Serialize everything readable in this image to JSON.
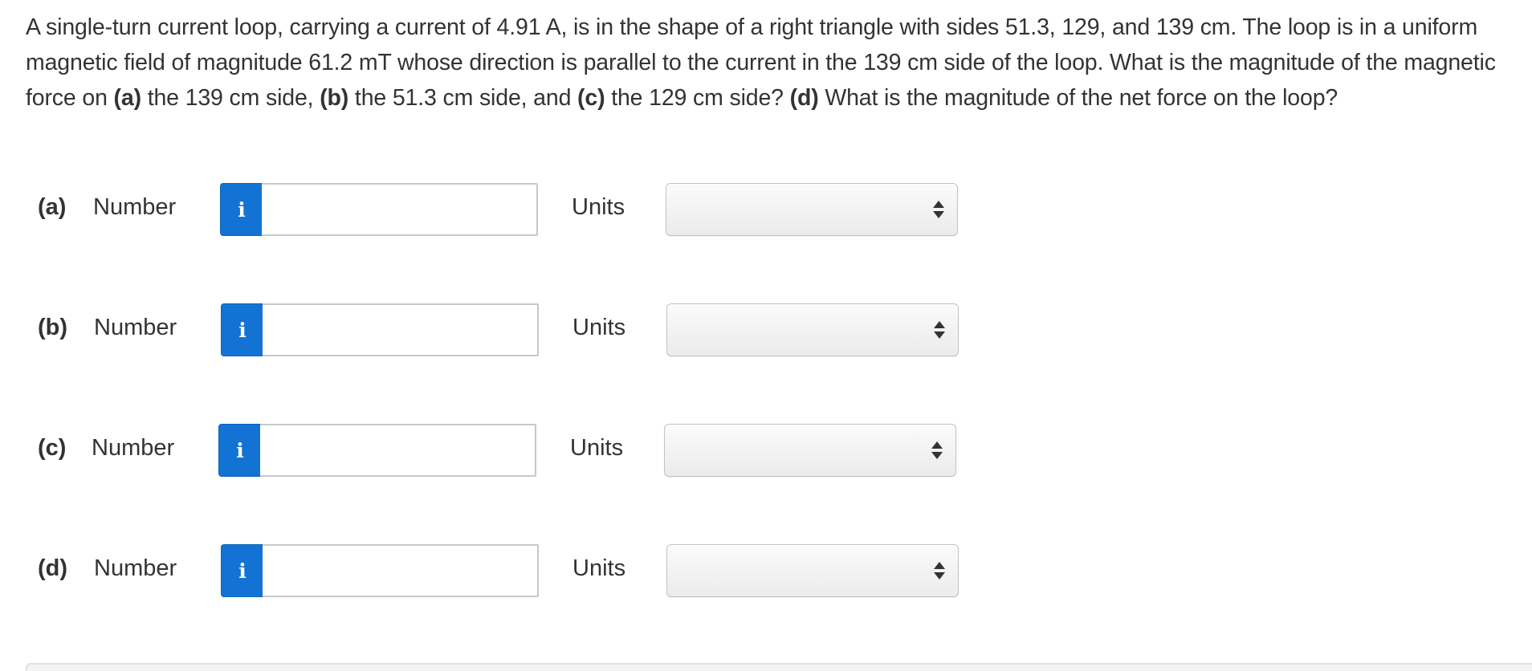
{
  "question": {
    "t1": "A single-turn current loop, carrying a current of 4.91 A, is in the shape of a right triangle with sides 51.3, 129, and 139 cm. The loop is in a uniform magnetic field of magnitude 61.2 mT whose direction is parallel to the current in the 139 cm side of the loop. What is the magnitude of the magnetic force on ",
    "a": "(a)",
    "t2": " the 139 cm side, ",
    "b": "(b)",
    "t3": " the 51.3 cm side, and ",
    "c": "(c)",
    "t4": " the 129 cm side? ",
    "d": "(d)",
    "t5": " What is the magnitude of the net force on the loop?"
  },
  "rows": [
    {
      "part": "(a)",
      "number_label": "Number",
      "info": "i",
      "value": "",
      "units_label": "Units",
      "units_value": ""
    },
    {
      "part": "(b)",
      "number_label": "Number",
      "info": "i",
      "value": "",
      "units_label": "Units",
      "units_value": ""
    },
    {
      "part": "(c)",
      "number_label": "Number",
      "info": "i",
      "value": "",
      "units_label": "Units",
      "units_value": ""
    },
    {
      "part": "(d)",
      "number_label": "Number",
      "info": "i",
      "value": "",
      "units_label": "Units",
      "units_value": ""
    }
  ],
  "colors": {
    "info_button": "#1373d5",
    "text": "#333333"
  }
}
